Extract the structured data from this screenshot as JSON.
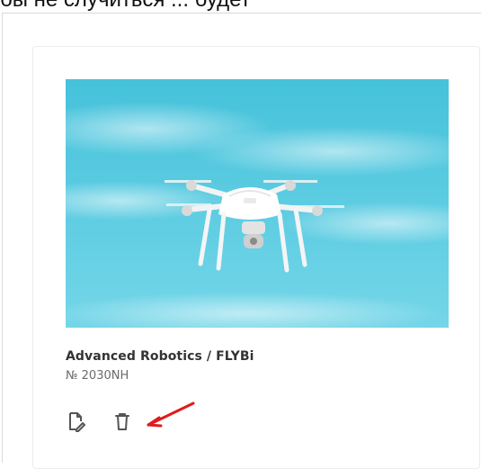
{
  "header": {
    "clipped_text": "бы не случиться ... будет"
  },
  "card": {
    "image_alt": "Drone photo",
    "title": "Advanced Robotics / FLYBi",
    "serial": "№ 2030NH",
    "actions": [
      {
        "name": "edit",
        "icon": "edit-document-icon"
      },
      {
        "name": "delete",
        "icon": "trash-icon"
      }
    ]
  },
  "colors": {
    "sky_top": "#4cc4dc",
    "sky_bottom": "#6fd3e6",
    "icon": "#555555",
    "annotation_arrow": "#e01b1b"
  }
}
